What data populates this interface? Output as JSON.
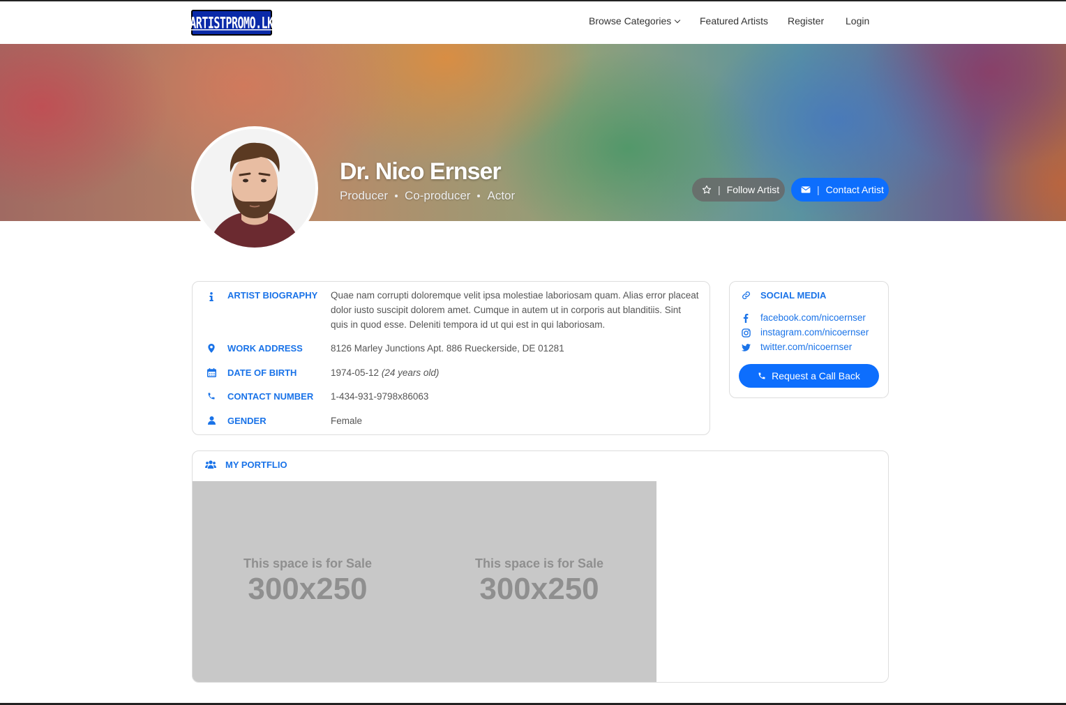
{
  "nav": {
    "logo_text": "ARTISTPROMO.LK",
    "items": [
      {
        "label": "Browse Categories"
      },
      {
        "label": "Featured Artists"
      },
      {
        "label": "Register"
      },
      {
        "label": "Login"
      }
    ]
  },
  "profile": {
    "name": "Dr. Nico Ernser",
    "roles": [
      "Producer",
      "Co-producer",
      "Actor"
    ],
    "follow_label": "Follow Artist",
    "contact_label": "Contact Artist"
  },
  "info": {
    "biography_label": "ARTIST BIOGRAPHY",
    "biography": "Quae nam corrupti doloremque velit ipsa molestiae laboriosam quam. Alias error placeat dolor iusto suscipit dolorem amet. Cumque in autem ut in corporis aut blanditiis. Sint quis in quod esse. Deleniti tempora id ut qui est in qui laboriosam.",
    "address_label": "WORK ADDRESS",
    "address": "8126 Marley Junctions Apt. 886 Rueckerside, DE 01281",
    "dob_label": "DATE OF BIRTH",
    "dob": "1974-05-12",
    "age": "(24 years old)",
    "phone_label": "CONTACT NUMBER",
    "phone": "1-434-931-9798x86063",
    "gender_label": "GENDER",
    "gender": "Female"
  },
  "social": {
    "title": "SOCIAL MEDIA",
    "facebook": "facebook.com/nicoernser",
    "instagram": "instagram.com/nicoernser",
    "twitter": "twitter.com/nicoernser",
    "callback_label": "Request a Call Back"
  },
  "portfolio": {
    "title": "MY PORTFLIO",
    "ads": [
      {
        "line1": "This space is for Sale",
        "line2": "300x250"
      },
      {
        "line1": "This space is for Sale",
        "line2": "300x250"
      }
    ]
  },
  "colors": {
    "accent": "#1a73e8",
    "button_blue": "#0d6efd",
    "follow_gray": "#696969"
  }
}
